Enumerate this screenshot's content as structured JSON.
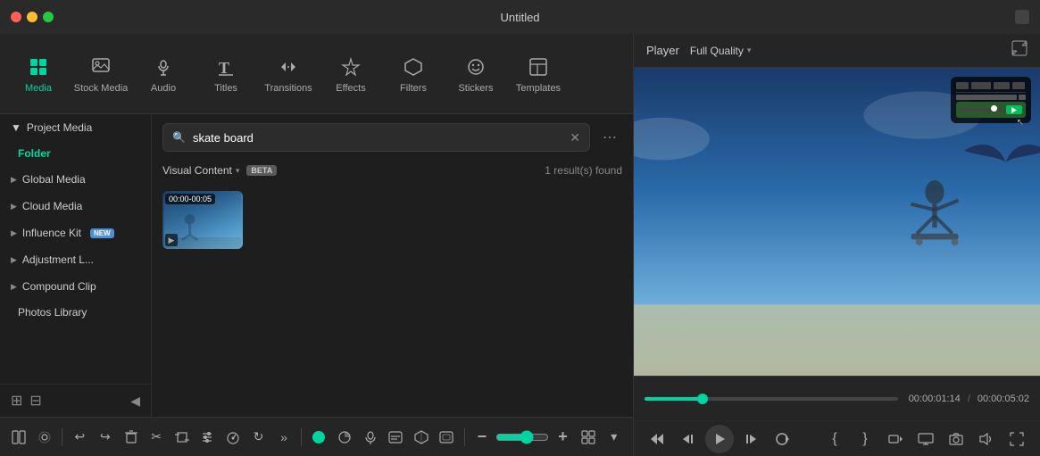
{
  "titlebar": {
    "title": "Untitled"
  },
  "toolbar": {
    "items": [
      {
        "id": "media",
        "label": "Media",
        "icon": "▦",
        "active": true
      },
      {
        "id": "stock-media",
        "label": "Stock Media",
        "icon": "🖼"
      },
      {
        "id": "audio",
        "label": "Audio",
        "icon": "♪"
      },
      {
        "id": "titles",
        "label": "Titles",
        "icon": "T"
      },
      {
        "id": "transitions",
        "label": "Transitions",
        "icon": "↔"
      },
      {
        "id": "effects",
        "label": "Effects",
        "icon": "✦"
      },
      {
        "id": "filters",
        "label": "Filters",
        "icon": "⬡"
      },
      {
        "id": "stickers",
        "label": "Stickers",
        "icon": "❋"
      },
      {
        "id": "templates",
        "label": "Templates",
        "icon": "▤"
      }
    ]
  },
  "sidebar": {
    "project_media": {
      "label": "Project Media",
      "expanded": true
    },
    "folder": {
      "label": "Folder",
      "active": true
    },
    "items": [
      {
        "id": "global-media",
        "label": "Global Media",
        "badge": null
      },
      {
        "id": "cloud-media",
        "label": "Cloud Media",
        "badge": null
      },
      {
        "id": "influence-kit",
        "label": "Influence Kit",
        "badge": "NEW"
      },
      {
        "id": "adjustment-l",
        "label": "Adjustment L...",
        "badge": null
      },
      {
        "id": "compound-clip",
        "label": "Compound Clip",
        "badge": null
      },
      {
        "id": "photos-library",
        "label": "Photos Library",
        "badge": null
      }
    ],
    "footer_icons": [
      "folder-add-icon",
      "folder-icon",
      "collapse-icon"
    ]
  },
  "content": {
    "search": {
      "placeholder": "skate board",
      "value": "skate board"
    },
    "filter": {
      "label": "Visual Content",
      "badge": "BETA"
    },
    "result_count": "1 result(s) found",
    "media_items": [
      {
        "duration": "00:00-00:05",
        "type": "video"
      }
    ]
  },
  "player": {
    "title": "Player",
    "quality": "Full Quality",
    "current_time": "00:00:01:14",
    "total_time": "00:00:05:02",
    "progress_percent": 23
  },
  "bottom_toolbar": {
    "buttons": [
      {
        "id": "split",
        "icon": "⊞",
        "label": "split"
      },
      {
        "id": "ripple",
        "icon": "◈",
        "label": "ripple"
      },
      {
        "id": "undo",
        "icon": "↩",
        "label": "undo"
      },
      {
        "id": "redo",
        "icon": "↪",
        "label": "redo"
      },
      {
        "id": "delete",
        "icon": "⌫",
        "label": "delete"
      },
      {
        "id": "cut",
        "icon": "✂",
        "label": "cut"
      },
      {
        "id": "crop",
        "icon": "⊡",
        "label": "crop"
      },
      {
        "id": "audio-mix",
        "icon": "♬",
        "label": "audio-mix"
      },
      {
        "id": "speed",
        "icon": "⊙",
        "label": "speed"
      },
      {
        "id": "rotate",
        "icon": "↻",
        "label": "rotate"
      },
      {
        "id": "more",
        "icon": "»",
        "label": "more"
      },
      {
        "id": "pip",
        "icon": "●",
        "label": "pip",
        "active": true
      },
      {
        "id": "color",
        "icon": "☀",
        "label": "color"
      },
      {
        "id": "voice",
        "icon": "♦",
        "label": "voice"
      },
      {
        "id": "subtitle",
        "icon": "▤",
        "label": "subtitle"
      },
      {
        "id": "ar",
        "icon": "⚙",
        "label": "ar"
      },
      {
        "id": "overlay",
        "icon": "⊟",
        "label": "overlay"
      },
      {
        "id": "minus",
        "icon": "−",
        "label": "zoom-out"
      },
      {
        "id": "plus",
        "icon": "+",
        "label": "zoom-in"
      },
      {
        "id": "grid",
        "icon": "⊞",
        "label": "grid-view"
      }
    ]
  }
}
